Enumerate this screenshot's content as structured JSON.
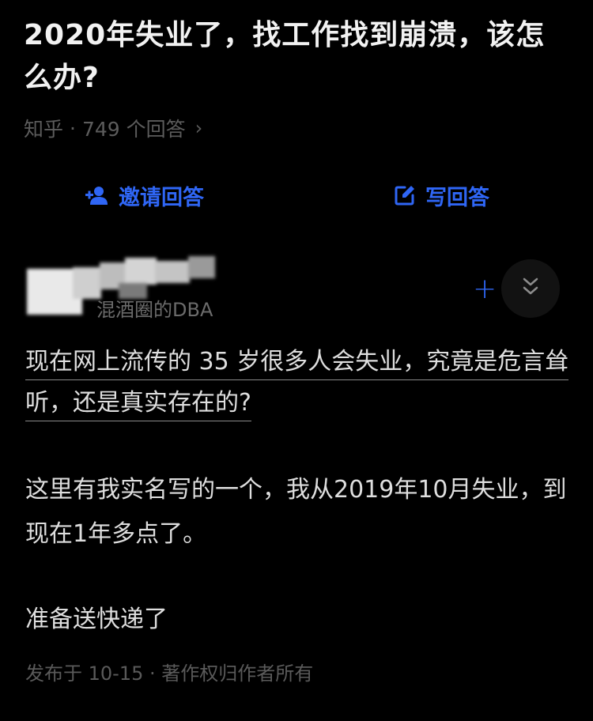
{
  "question": {
    "title": "2020年失业了，找工作找到崩溃，该怎么办?",
    "source": "知乎",
    "separator": "·",
    "answer_count": "749 个回答",
    "chevron": "›"
  },
  "actions": {
    "invite_label": "邀请回答",
    "write_label": "写回答"
  },
  "author": {
    "subtitle": "混酒圈的DBA",
    "follow_symbol": "+"
  },
  "answer": {
    "quote_line": "现在网上流传的 35 岁很多人会失业，究竟是危言耸听，还是真实存在的?",
    "paragraph_1": "这里有我实名写的一个，我从2019年10月失业，到现在1年多点了。",
    "paragraph_2": "准备送快递了"
  },
  "footer": {
    "meta": "发布于 10-15 · 著作权归作者所有"
  },
  "colors": {
    "accent": "#2f66f5",
    "background": "#000000",
    "text": "#dedede",
    "muted": "#5c5c5c"
  },
  "icons": {
    "invite": "add-person-icon",
    "write": "edit-icon",
    "collapse": "double-chevron-down-icon"
  }
}
